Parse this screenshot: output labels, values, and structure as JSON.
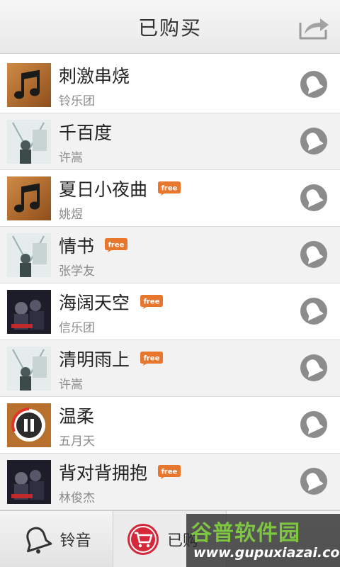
{
  "header": {
    "title": "已购买",
    "share_icon": "share-export-icon"
  },
  "songs": [
    {
      "title": "刺激串烧",
      "artist": "铃乐团",
      "free": false,
      "cover": "music-note"
    },
    {
      "title": "千百度",
      "artist": "许嵩",
      "free": false,
      "cover": "album-photo-light"
    },
    {
      "title": "夏日小夜曲",
      "artist": "姚煜",
      "free": true,
      "cover": "music-note"
    },
    {
      "title": "情书",
      "artist": "张学友",
      "free": true,
      "cover": "album-photo-light"
    },
    {
      "title": "海阔天空",
      "artist": "信乐团",
      "free": true,
      "cover": "album-photo-dark"
    },
    {
      "title": "清明雨上",
      "artist": "许嵩",
      "free": true,
      "cover": "album-photo-light"
    },
    {
      "title": "温柔",
      "artist": "五月天",
      "free": false,
      "cover": "pause-playing"
    },
    {
      "title": "背对背拥抱",
      "artist": "林俊杰",
      "free": true,
      "cover": "album-photo-dark"
    }
  ],
  "badges": {
    "free_label": "free"
  },
  "footer": {
    "tab_ringtone_label": "铃音",
    "tab_purchased_label": "已购"
  },
  "watermark": {
    "logo": "谷普软件园",
    "url": "www.gupuxiazai.com"
  },
  "colors": {
    "badge_orange": "#e8772e",
    "icon_gray": "#8c8c8c",
    "cover_wood": "#b36a2a",
    "footer_cart_red": "#d6283b"
  }
}
